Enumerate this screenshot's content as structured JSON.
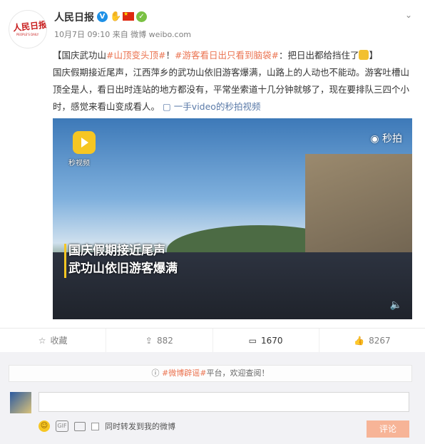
{
  "post": {
    "author": "人民日报",
    "meta": "10月7日 09:10 来自 微博 weibo.com",
    "avatar_logo": "人民日报",
    "avatar_sub": "PEOPLE'S DAILY",
    "text_open": "【国庆武功山",
    "tag1": "#山顶变头顶#",
    "text_mid1": "！",
    "tag2": "#游客看日出只看到脑袋#",
    "text_mid2": "：把日出都给挡住了",
    "text_close": "】",
    "body": "国庆假期接近尾声，江西萍乡的武功山依旧游客爆满，山路上的人动也不能动。游客吐槽山顶全是人，看日出时连站的地方都没有，平常坐索道十几分钟就够了，现在要排队三四个小时，感觉来看山变成看人。",
    "video_link": "一手video的秒拍视频"
  },
  "video": {
    "logo_label": "秒视频",
    "watermark": "◉ 秒拍",
    "caption_line1": "国庆假期接近尾声",
    "caption_line2": "武功山依旧游客爆满"
  },
  "actions": {
    "favorite": "收藏",
    "repost": "882",
    "comment": "1670",
    "like": "8267"
  },
  "comment_box": {
    "notice_prefix": "#微博辟谣#",
    "notice_suffix": "平台，欢迎查阅！",
    "sync_label": "同时转发到我的微博",
    "submit": "评论"
  },
  "colors": {
    "tag": "#eb7350",
    "link": "#5a7aa8",
    "submit_bg": "#f7b497"
  }
}
